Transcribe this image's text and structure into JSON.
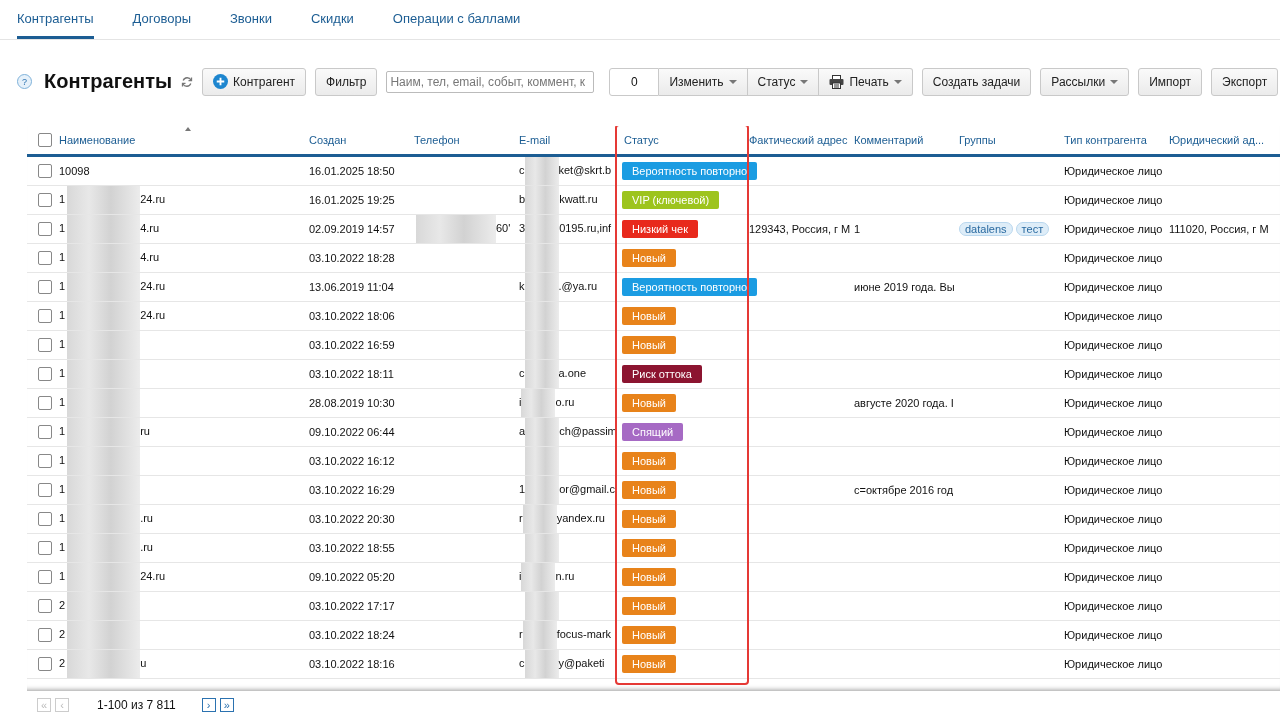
{
  "tabs": [
    {
      "label": "Контрагенты",
      "selected": true
    },
    {
      "label": "Договоры",
      "selected": false
    },
    {
      "label": "Звонки",
      "selected": false
    },
    {
      "label": "Скидки",
      "selected": false
    },
    {
      "label": "Операции с баллами",
      "selected": false
    }
  ],
  "toolbar": {
    "help": "?",
    "title": "Контрагенты",
    "add_button": "Контрагент",
    "filter_button": "Фильтр",
    "search": {
      "placeholder": "Наим, тел, email, событ, коммент, к"
    },
    "selected_count": "0",
    "actions": [
      {
        "label": "Изменить",
        "dropdown": true
      },
      {
        "label": "Статус",
        "dropdown": true
      },
      {
        "label": "Печать",
        "dropdown": true
      }
    ],
    "buttons": [
      {
        "label": "Создать задачи",
        "dropdown": false
      },
      {
        "label": "Рассылки",
        "dropdown": true
      },
      {
        "label": "Импорт",
        "dropdown": false
      },
      {
        "label": "Экспорт",
        "dropdown": false
      }
    ]
  },
  "table": {
    "all_checked": false,
    "columns": [
      {
        "label": "Наименование",
        "sorted": true,
        "highlighted": false
      },
      {
        "label": "Создан",
        "sorted": false,
        "highlighted": false
      },
      {
        "label": "Телефон",
        "sorted": false,
        "highlighted": false
      },
      {
        "label": "E-mail",
        "sorted": false,
        "highlighted": false
      },
      {
        "label": "Статус",
        "sorted": false,
        "highlighted": true
      },
      {
        "label": "Фактический адрес",
        "sorted": false,
        "highlighted": false
      },
      {
        "label": "Комментарий",
        "sorted": false,
        "highlighted": false
      },
      {
        "label": "Группы",
        "sorted": false,
        "highlighted": false
      },
      {
        "label": "Тип контрагента",
        "sorted": false,
        "highlighted": false
      },
      {
        "label": "Юридический ад...",
        "sorted": false,
        "highlighted": false
      }
    ],
    "rows": [
      {
        "checked": false,
        "name": {
          "start": "10098",
          "redacted": false
        },
        "created": "16.01.2025 18:50",
        "phone": {
          "redacted": false
        },
        "email": {
          "start": "c",
          "end": "ket@skrt.b",
          "redacted": true
        },
        "status": {
          "label": "Вероятность повторно",
          "color": "#1b9ce2"
        },
        "type": "Юридическое лицо"
      },
      {
        "checked": false,
        "name": {
          "start": "1",
          "end": "24.ru",
          "redacted": true
        },
        "created": "16.01.2025 19:25",
        "phone": {
          "redacted": false
        },
        "email": {
          "start": "b",
          "end": "kwatt.ru",
          "redacted": true
        },
        "status": {
          "label": "VIP (ключевой)",
          "color": "#9dc41d"
        },
        "type": "Юридическое лицо"
      },
      {
        "checked": false,
        "name": {
          "start": "1",
          "end": "4.ru",
          "redacted": true
        },
        "created": "02.09.2019 14:57",
        "phone": {
          "end": "60'",
          "redacted": true
        },
        "email": {
          "start": "3",
          "end": "0195.ru,inf",
          "redacted": true
        },
        "status": {
          "label": "Низкий чек",
          "color": "#e8291c"
        },
        "address": "129343, Россия, г М",
        "comment": "1",
        "groups": [
          "datalens",
          "тест"
        ],
        "type": "Юридическое лицо",
        "legal_address": "111020, Россия, г М"
      },
      {
        "checked": false,
        "name": {
          "start": "1",
          "end": "4.ru",
          "redacted": true
        },
        "created": "03.10.2022 18:28",
        "phone": {
          "redacted": false
        },
        "email": {
          "redacted": true
        },
        "status": {
          "label": "Новый",
          "color": "#e8831a"
        },
        "type": "Юридическое лицо"
      },
      {
        "checked": false,
        "name": {
          "start": "1",
          "end": "24.ru",
          "redacted": true
        },
        "created": "13.06.2019 11:04",
        "phone": {
          "redacted": false
        },
        "email": {
          "start": "k",
          "end": ".@ya.ru",
          "redacted": true
        },
        "status": {
          "label": "Вероятность повторно",
          "color": "#1b9ce2"
        },
        "comment": "июне 2019 года. Вы",
        "type": "Юридическое лицо"
      },
      {
        "checked": false,
        "name": {
          "start": "1",
          "end": "24.ru",
          "redacted": true
        },
        "created": "03.10.2022 18:06",
        "phone": {
          "redacted": false
        },
        "email": {
          "redacted": true
        },
        "status": {
          "label": "Новый",
          "color": "#e8831a"
        },
        "type": "Юридическое лицо"
      },
      {
        "checked": false,
        "name": {
          "start": "1",
          "redacted": true
        },
        "created": "03.10.2022 16:59",
        "phone": {
          "redacted": false
        },
        "email": {
          "redacted": true
        },
        "status": {
          "label": "Новый",
          "color": "#e8831a"
        },
        "type": "Юридическое лицо"
      },
      {
        "checked": false,
        "name": {
          "start": "1",
          "redacted": true
        },
        "created": "03.10.2022 18:11",
        "phone": {
          "redacted": false
        },
        "email": {
          "start": "c",
          "end": "a.one",
          "redacted": true
        },
        "status": {
          "label": "Риск оттока",
          "color": "#8c1430"
        },
        "type": "Юридическое лицо"
      },
      {
        "checked": false,
        "name": {
          "start": "1",
          "redacted": true
        },
        "created": "28.08.2019 10:30",
        "phone": {
          "redacted": false
        },
        "email": {
          "start": "i",
          "end": "o.ru",
          "redacted": true
        },
        "status": {
          "label": "Новый",
          "color": "#e8831a"
        },
        "comment": "августе 2020 года. I",
        "type": "Юридическое лицо"
      },
      {
        "checked": false,
        "name": {
          "start": "1",
          "end": "ru",
          "redacted": true
        },
        "created": "09.10.2022 06:44",
        "phone": {
          "redacted": false
        },
        "email": {
          "start": "a",
          "end": "ch@passim",
          "redacted": true
        },
        "status": {
          "label": "Спящий",
          "color": "#a66ac4"
        },
        "type": "Юридическое лицо"
      },
      {
        "checked": false,
        "name": {
          "start": "1",
          "redacted": true
        },
        "created": "03.10.2022 16:12",
        "phone": {
          "redacted": false
        },
        "email": {
          "redacted": true
        },
        "status": {
          "label": "Новый",
          "color": "#e8831a"
        },
        "type": "Юридическое лицо"
      },
      {
        "checked": false,
        "name": {
          "start": "1",
          "redacted": true
        },
        "created": "03.10.2022 16:29",
        "phone": {
          "redacted": false
        },
        "email": {
          "start": "1",
          "end": "or@gmail.c",
          "redacted": true
        },
        "status": {
          "label": "Новый",
          "color": "#e8831a"
        },
        "comment": "с=октябре 2016 год",
        "type": "Юридическое лицо"
      },
      {
        "checked": false,
        "name": {
          "start": "1",
          "end": ".ru",
          "redacted": true
        },
        "created": "03.10.2022 20:30",
        "phone": {
          "redacted": false
        },
        "email": {
          "start": "r",
          "end": "yandex.ru",
          "redacted": true
        },
        "status": {
          "label": "Новый",
          "color": "#e8831a"
        },
        "type": "Юридическое лицо"
      },
      {
        "checked": false,
        "name": {
          "start": "1",
          "end": ".ru",
          "redacted": true
        },
        "created": "03.10.2022 18:55",
        "phone": {
          "redacted": false
        },
        "email": {
          "redacted": true
        },
        "status": {
          "label": "Новый",
          "color": "#e8831a"
        },
        "type": "Юридическое лицо"
      },
      {
        "checked": false,
        "name": {
          "start": "1",
          "end": "24.ru",
          "redacted": true
        },
        "created": "09.10.2022 05:20",
        "phone": {
          "redacted": false
        },
        "email": {
          "start": "i",
          "end": "n.ru",
          "redacted": true
        },
        "status": {
          "label": "Новый",
          "color": "#e8831a"
        },
        "type": "Юридическое лицо"
      },
      {
        "checked": false,
        "name": {
          "start": "2",
          "redacted": true
        },
        "created": "03.10.2022 17:17",
        "phone": {
          "redacted": false
        },
        "email": {
          "redacted": true
        },
        "status": {
          "label": "Новый",
          "color": "#e8831a"
        },
        "type": "Юридическое лицо"
      },
      {
        "checked": false,
        "name": {
          "start": "2",
          "redacted": true
        },
        "created": "03.10.2022 18:24",
        "phone": {
          "redacted": false
        },
        "email": {
          "start": "r",
          "end": "focus-mark",
          "redacted": true
        },
        "status": {
          "label": "Новый",
          "color": "#e8831a"
        },
        "type": "Юридическое лицо"
      },
      {
        "checked": false,
        "name": {
          "start": "2",
          "end": "u",
          "redacted": true
        },
        "created": "03.10.2022 18:16",
        "phone": {
          "redacted": false
        },
        "email": {
          "start": "c",
          "end": "y@paketi",
          "redacted": true
        },
        "status": {
          "label": "Новый",
          "color": "#e8831a"
        },
        "type": "Юридическое лицо"
      }
    ]
  },
  "pagination": {
    "range": "1-100 из 7 811",
    "controls": [
      {
        "label": "«",
        "disabled": true
      },
      {
        "label": "‹",
        "disabled": true
      }
    ],
    "controls_after": [
      {
        "label": "›",
        "disabled": false
      },
      {
        "label": "»",
        "disabled": false
      }
    ]
  }
}
